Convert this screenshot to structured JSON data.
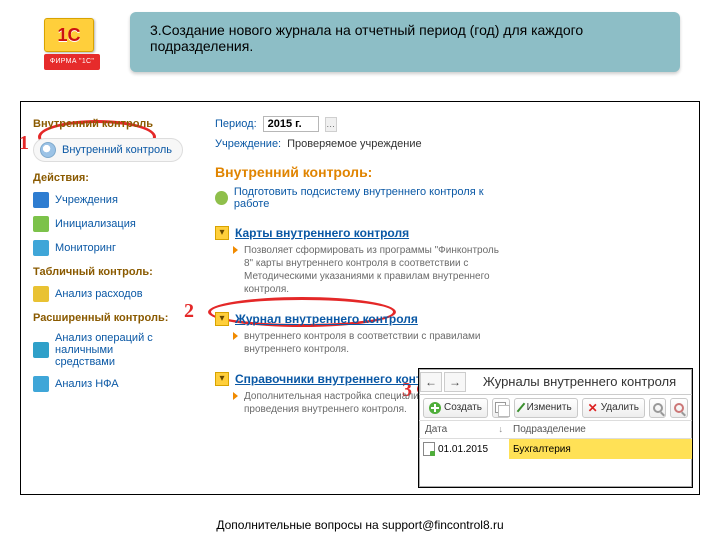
{
  "banner": {
    "text": "3.Создание нового журнала на отчетный период (год) для каждого подразделения."
  },
  "logo": {
    "big": "1C",
    "ribbon": "ФИРМА \"1С\""
  },
  "sidebar": {
    "sections": [
      {
        "title": "Внутренний контроль",
        "items": [
          {
            "label": "Внутренний контроль",
            "icon": "#9cc3e6"
          }
        ]
      },
      {
        "title": "Действия:",
        "items": [
          {
            "label": "Учреждения",
            "icon": "#2e7dd1"
          },
          {
            "label": "Инициализация",
            "icon": "#7cc24a"
          },
          {
            "label": "Мониторинг",
            "icon": "#3fa6d8"
          }
        ]
      },
      {
        "title": "Табличный контроль:",
        "items": [
          {
            "label": "Анализ расходов",
            "icon": "#e9c233"
          }
        ]
      },
      {
        "title": "Расширенный контроль:",
        "items": [
          {
            "label": "Анализ операций с наличными средствами",
            "icon": "#2fa0c9"
          },
          {
            "label": "Анализ НФА",
            "icon": "#3fa6d8"
          }
        ]
      }
    ]
  },
  "main": {
    "period_label": "Период:",
    "period_value": "2015 г.",
    "org_label": "Учреждение:",
    "org_value": "Проверяемое учреждение",
    "heading": "Внутренний контроль:",
    "prepare": "Подготовить подсистему внутреннего контроля к работе",
    "sections": [
      {
        "title": "Карты внутреннего контроля",
        "desc": "Позволяет сформировать из программы \"Финконтроль 8\" карты внутреннего контроля в соответствии с Методическими указаниями к правилам внутреннего контроля."
      },
      {
        "title": "Журнал внутреннего контроля",
        "desc": "внутреннего контроля в соответствии с правилами внутреннего контроля."
      },
      {
        "title": "Справочники внутреннего контроля",
        "desc": "Дополнительная настройка специализированного проведения внутреннего контроля."
      }
    ]
  },
  "annotations": {
    "n1": "1",
    "n2": "2",
    "n3": "3"
  },
  "journal": {
    "title": "Журналы внутреннего контроля",
    "buttons": {
      "create": "Создать",
      "edit": "Изменить",
      "delete": "Удалить"
    },
    "cols": {
      "date": "Дата",
      "dept": "Подразделение"
    },
    "row": {
      "date": "01.01.2015",
      "dept": "Бухгалтерия"
    }
  },
  "footer": "Дополнительные вопросы на support@fincontrol8.ru"
}
